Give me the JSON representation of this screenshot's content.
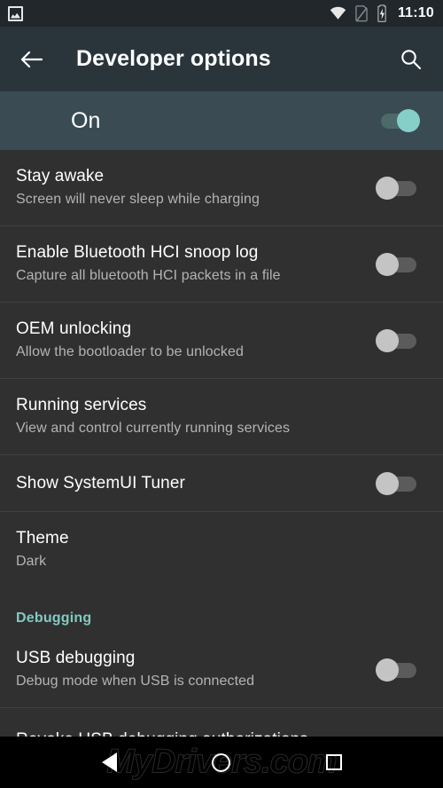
{
  "status_bar": {
    "notification_icon": "photo-icon",
    "wifi_icon": "wifi-icon",
    "sim_icon": "no-sim-icon",
    "battery_icon": "battery-charging-icon",
    "clock": "11:10"
  },
  "app_bar": {
    "back_icon": "back-arrow-icon",
    "title": "Developer options",
    "search_icon": "search-icon"
  },
  "master_switch": {
    "label": "On",
    "state": "on"
  },
  "settings": [
    {
      "title": "Stay awake",
      "subtitle": "Screen will never sleep while charging",
      "control": "switch",
      "state": "off"
    },
    {
      "title": "Enable Bluetooth HCI snoop log",
      "subtitle": "Capture all bluetooth HCI packets in a file",
      "control": "switch",
      "state": "off"
    },
    {
      "title": "OEM unlocking",
      "subtitle": "Allow the bootloader to be unlocked",
      "control": "switch",
      "state": "off"
    },
    {
      "title": "Running services",
      "subtitle": "View and control currently running services",
      "control": "none",
      "state": ""
    },
    {
      "title": "Show SystemUI Tuner",
      "subtitle": "",
      "control": "switch",
      "state": "off"
    },
    {
      "title": "Theme",
      "subtitle": "Dark",
      "control": "none",
      "state": ""
    }
  ],
  "debugging_section": {
    "header": "Debugging",
    "items": [
      {
        "title": "USB debugging",
        "subtitle": "Debug mode when USB is connected",
        "control": "switch",
        "state": "off"
      }
    ]
  },
  "cut_off_row": {
    "title": "Revoke USB debugging authorizations"
  },
  "nav_bar": {
    "back_icon": "nav-back-icon",
    "home_icon": "nav-home-icon",
    "recent_icon": "nav-recents-icon",
    "watermark": "MyDrivers.com"
  },
  "colors": {
    "accent_teal": "#80cbc4",
    "app_bar": "#2a353b",
    "master_row": "#3a4b53",
    "list_background": "#303030",
    "status_bar": "#21272b",
    "nav_bar": "#000000"
  }
}
